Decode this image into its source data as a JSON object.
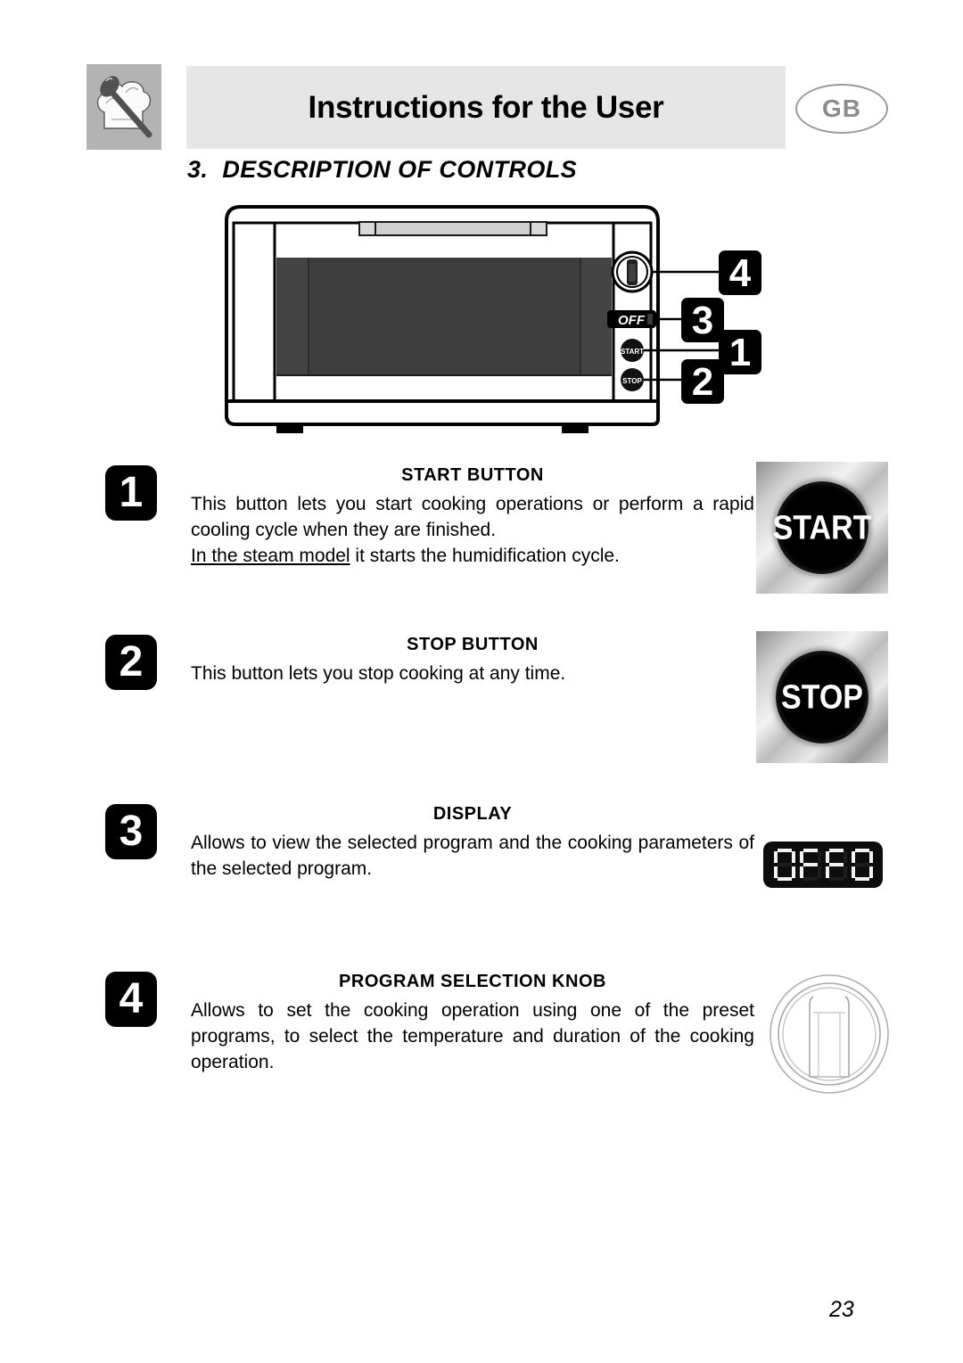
{
  "header": {
    "title": "Instructions for the User",
    "language_badge": "GB",
    "logo_icon": "chef-hat-spoon-icon"
  },
  "section": {
    "number": "3.",
    "title": "DESCRIPTION OF CONTROLS"
  },
  "figure": {
    "name": "oven-front-view-diagram",
    "display_text": "OFF",
    "start_button_label": "START",
    "stop_button_label": "STOP",
    "callouts": [
      {
        "number": "4",
        "target": "program-selection-knob"
      },
      {
        "number": "3",
        "target": "display"
      },
      {
        "number": "1",
        "target": "start-button"
      },
      {
        "number": "2",
        "target": "stop-button"
      }
    ]
  },
  "items": [
    {
      "number": "1",
      "heading": "START BUTTON",
      "body_line_1": "This button lets you start cooking operations or perform a rapid cooling cycle when they are finished.",
      "body_underlined": "In the steam model",
      "body_line_2": " it starts the humidification cycle.",
      "graphic": "start-button-photo",
      "graphic_label": "START"
    },
    {
      "number": "2",
      "heading": "STOP BUTTON",
      "body_line_1": "This button lets you stop cooking at any time.",
      "graphic": "stop-button-photo",
      "graphic_label": "STOP"
    },
    {
      "number": "3",
      "heading": "DISPLAY",
      "body_line_1": "Allows to view the selected program and the cooking parameters of the selected program.",
      "graphic": "display-photo",
      "graphic_label": "OFF"
    },
    {
      "number": "4",
      "heading": "PROGRAM SELECTION KNOB",
      "body_line_1": "Allows to set the cooking operation using one of the preset programs, to select the temperature and duration of the cooking operation.",
      "graphic": "program-selection-knob-drawing"
    }
  ],
  "footer": {
    "page_number": "23"
  },
  "colors": {
    "header_band": "#e6e6e6",
    "logo_background": "#b3b3b3",
    "badge_background": "#000000",
    "oven_glass": "#434343",
    "gb_text": "#8c8c8c"
  }
}
